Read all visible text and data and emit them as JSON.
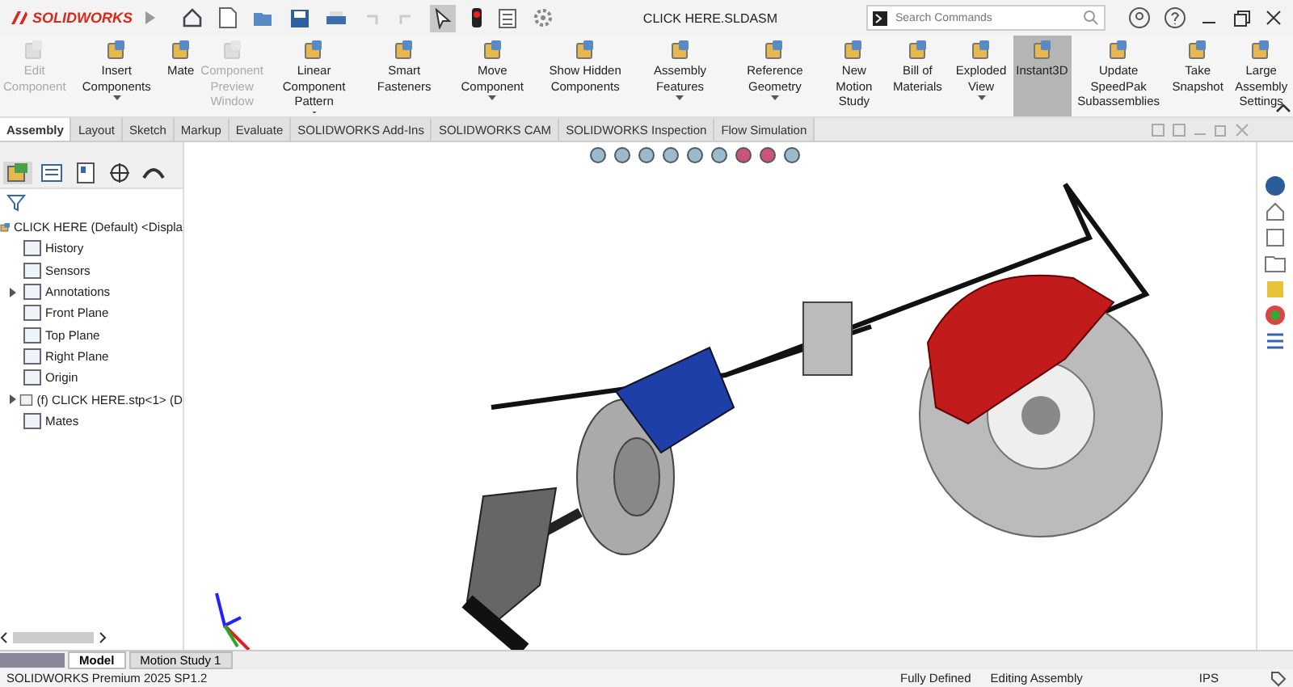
{
  "app": {
    "logo": "SOLIDWORKS",
    "title": "CLICK HERE.SLDASM",
    "search": {
      "placeholder": "Search Commands"
    },
    "select_tool_selected": true
  },
  "ribbon": [
    {
      "label": "Edit Component",
      "disabled": true,
      "selected": false,
      "dropdown": false
    },
    {
      "label": "Insert Components",
      "disabled": false,
      "selected": false,
      "dropdown": true
    },
    {
      "label": "Mate",
      "disabled": false,
      "selected": false,
      "dropdown": false
    },
    {
      "label": "Component Preview Window",
      "disabled": true,
      "selected": false,
      "dropdown": false
    },
    {
      "label": "Linear Component Pattern",
      "disabled": false,
      "selected": false,
      "dropdown": true
    },
    {
      "label": "Smart Fasteners",
      "disabled": false,
      "selected": false,
      "dropdown": false
    },
    {
      "label": "Move Component",
      "disabled": false,
      "selected": false,
      "dropdown": true
    },
    {
      "label": "Show Hidden Components",
      "disabled": false,
      "selected": false,
      "dropdown": false
    },
    {
      "label": "Assembly Features",
      "disabled": false,
      "selected": false,
      "dropdown": true
    },
    {
      "label": "Reference Geometry",
      "disabled": false,
      "selected": false,
      "dropdown": true
    },
    {
      "label": "New Motion Study",
      "disabled": false,
      "selected": false,
      "dropdown": false
    },
    {
      "label": "Bill of Materials",
      "disabled": false,
      "selected": false,
      "dropdown": false
    },
    {
      "label": "Exploded View",
      "disabled": false,
      "selected": false,
      "dropdown": true
    },
    {
      "label": "Instant3D",
      "disabled": false,
      "selected": true,
      "dropdown": false
    },
    {
      "label": "Update SpeedPak Subassemblies",
      "disabled": false,
      "selected": false,
      "dropdown": false
    },
    {
      "label": "Take Snapshot",
      "disabled": false,
      "selected": false,
      "dropdown": false
    },
    {
      "label": "Large Assembly Settings",
      "disabled": false,
      "selected": false,
      "dropdown": false
    }
  ],
  "tabs": [
    {
      "label": "Assembly",
      "selected": true
    },
    {
      "label": "Layout",
      "selected": false
    },
    {
      "label": "Sketch",
      "selected": false
    },
    {
      "label": "Markup",
      "selected": false
    },
    {
      "label": "Evaluate",
      "selected": false
    },
    {
      "label": "SOLIDWORKS Add-Ins",
      "selected": false
    },
    {
      "label": "SOLIDWORKS CAM",
      "selected": false
    },
    {
      "label": "SOLIDWORKS Inspection",
      "selected": false
    },
    {
      "label": "Flow Simulation",
      "selected": false
    }
  ],
  "tree": {
    "label": "CLICK HERE (Default) <Displa",
    "children": [
      {
        "label": "History",
        "expandable": false
      },
      {
        "label": "Sensors",
        "expandable": false
      },
      {
        "label": "Annotations",
        "expandable": true
      },
      {
        "label": "Front Plane",
        "expandable": false
      },
      {
        "label": "Top Plane",
        "expandable": false
      },
      {
        "label": "Right Plane",
        "expandable": false
      },
      {
        "label": "Origin",
        "expandable": false
      },
      {
        "label": "(f) CLICK HERE.stp<1> (D",
        "expandable": true
      },
      {
        "label": "Mates",
        "expandable": false
      }
    ]
  },
  "bottom_tabs": [
    {
      "label": "Model",
      "selected": true
    },
    {
      "label": "Motion Study 1",
      "selected": false
    }
  ],
  "status_bar": {
    "product": "SOLIDWORKS Premium 2025 SP1.2",
    "state": "Fully Defined",
    "mode": "Editing Assembly",
    "units": "IPS"
  }
}
